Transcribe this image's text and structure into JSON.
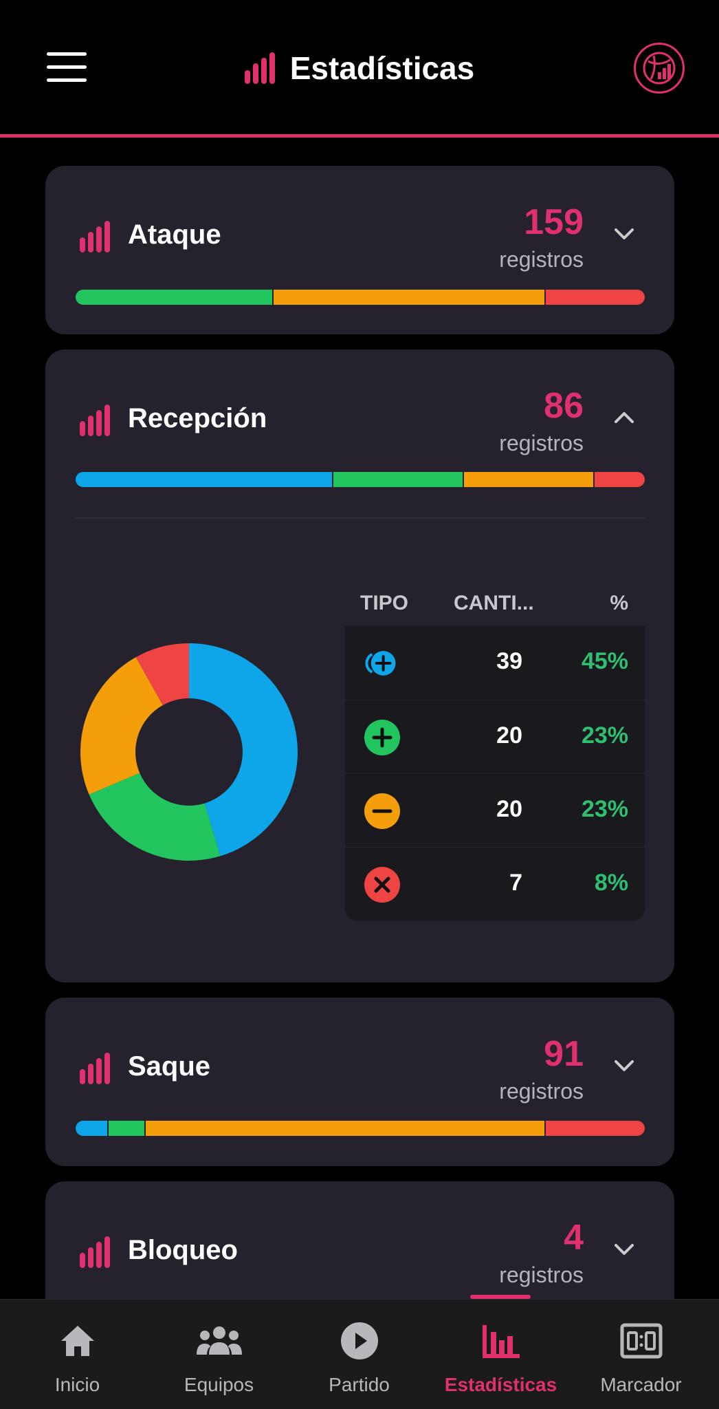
{
  "header": {
    "title": "Estadísticas",
    "menu_icon": "hamburger-menu-icon",
    "logo_icon": "volleyball-stats-logo-icon"
  },
  "colors": {
    "accent": "#e0306e",
    "blue": "#0ea5e9",
    "green": "#22c55e",
    "orange": "#f59e0b",
    "red": "#ef4444"
  },
  "cards": [
    {
      "title": "Ataque",
      "count": "159",
      "count_label": "registros",
      "expanded": false,
      "bar_fractions": [
        {
          "color": "#22c55e",
          "fraction": 0.346
        },
        {
          "color": "#f59e0b",
          "fraction": 0.478
        },
        {
          "color": "#ef4444",
          "fraction": 0.176
        }
      ]
    },
    {
      "title": "Recepción",
      "count": "86",
      "count_label": "registros",
      "expanded": true,
      "bar_fractions": [
        {
          "color": "#0ea5e9",
          "fraction": 0.45
        },
        {
          "color": "#22c55e",
          "fraction": 0.23
        },
        {
          "color": "#f59e0b",
          "fraction": 0.23
        },
        {
          "color": "#ef4444",
          "fraction": 0.09
        }
      ]
    },
    {
      "title": "Saque",
      "count": "91",
      "count_label": "registros",
      "expanded": false,
      "bar_fractions": [
        {
          "color": "#0ea5e9",
          "fraction": 0.055
        },
        {
          "color": "#22c55e",
          "fraction": 0.066
        },
        {
          "color": "#f59e0b",
          "fraction": 0.703
        },
        {
          "color": "#ef4444",
          "fraction": 0.176
        }
      ]
    },
    {
      "title": "Bloqueo",
      "count": "4",
      "count_label": "registros",
      "expanded": false
    }
  ],
  "reception_table": {
    "headers": {
      "type": "TIPO",
      "qty": "CANTI...",
      "pct": "%"
    },
    "rows": [
      {
        "icon": "double-plus-icon",
        "color": "#0ea5e9",
        "qty": "39",
        "pct": "45%"
      },
      {
        "icon": "plus-icon",
        "color": "#22c55e",
        "qty": "20",
        "pct": "23%"
      },
      {
        "icon": "minus-icon",
        "color": "#f59e0b",
        "qty": "20",
        "pct": "23%"
      },
      {
        "icon": "x-icon",
        "color": "#ef4444",
        "qty": "7",
        "pct": "8%"
      }
    ]
  },
  "chart_data": {
    "type": "pie",
    "categories": [
      "Doble positivo",
      "Positivo",
      "Negativo",
      "Error"
    ],
    "values": [
      39,
      20,
      20,
      7
    ],
    "colors": [
      "#0ea5e9",
      "#22c55e",
      "#f59e0b",
      "#ef4444"
    ],
    "title": ""
  },
  "nav": {
    "items": [
      {
        "label": "Inicio",
        "icon": "home-icon"
      },
      {
        "label": "Equipos",
        "icon": "team-icon"
      },
      {
        "label": "Partido",
        "icon": "play-icon"
      },
      {
        "label": "Estadísticas",
        "icon": "bar-chart-icon"
      },
      {
        "label": "Marcador",
        "icon": "scoreboard-icon"
      }
    ],
    "active_index": 3
  }
}
